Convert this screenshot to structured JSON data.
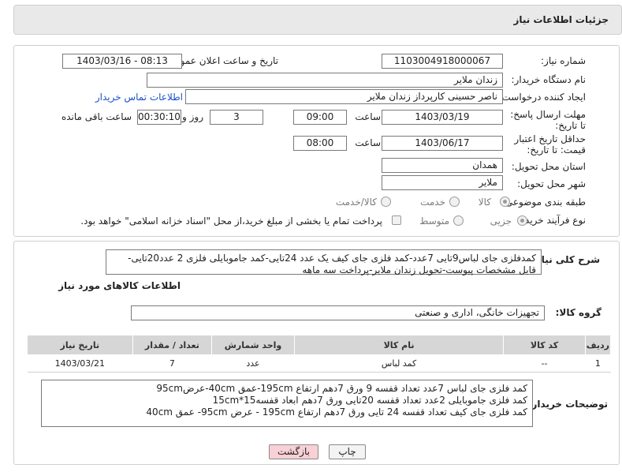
{
  "header": {
    "title": "جزئیات اطلاعات نیاز"
  },
  "form": {
    "need_number_label": "شماره نیاز:",
    "need_number": "1103004918000067",
    "announce_label": "تاریخ و ساعت اعلان عمومی:",
    "announce_value": "1403/03/16 - 08:13",
    "buyer_org_label": "نام دستگاه خریدار:",
    "buyer_org": "زندان ملایر",
    "creator_label": "ایجاد کننده درخواست:",
    "creator": "ناصر  حسینی کارپرداز زندان ملایر",
    "contact_link": "اطلاعات تماس خریدار",
    "reply_deadline_label": "مهلت ارسال پاسخ: تا تاریخ:",
    "reply_date": "1403/03/19",
    "time_label": "ساعت",
    "reply_time": "09:00",
    "days_value": "3",
    "days_label": "روز و",
    "remaining_value": "00:30:10",
    "remaining_label": "ساعت باقی مانده",
    "validity_label": "حداقل تاریخ اعتبار قیمت: تا تاریخ:",
    "validity_date": "1403/06/17",
    "validity_time_label": "ساعت",
    "validity_time": "08:00",
    "province_label": "استان محل تحویل:",
    "province": "همدان",
    "city_label": "شهر محل تحویل:",
    "city": "ملایر",
    "category_label": "طبقه بندی موضوعی:",
    "category_options": [
      "کالا",
      "خدمت",
      "کالا/خدمت"
    ],
    "purchase_type_label": "نوع فرآیند خرید :",
    "purchase_options": [
      "جزیی",
      "متوسط"
    ],
    "payment_note": "پرداخت تمام یا بخشی از مبلغ خرید،از محل \"اسناد خزانه اسلامی\" خواهد بود."
  },
  "summary": {
    "label": "شرح کلی نیاز:",
    "text": "کمدفلزی جای لباس9تایی 7عدد-کمد فلزی جای کیف یک عدد 24تایی-کمد جاموبایلی فلزی 2 عدد20تایی-قابل مشخصات پیوست-تحویل زندان ملایر-پرداخت سه ماهه"
  },
  "goods": {
    "section_title": "اطلاعات کالاهای مورد نیاز",
    "group_label": "گروه کالا:",
    "group_value": "تجهیزات خانگی، اداری و صنعتی",
    "columns": [
      "ردیف",
      "کد کالا",
      "نام کالا",
      "واحد شمارش",
      "تعداد / مقدار",
      "تاریخ نیاز"
    ],
    "rows": [
      {
        "row": "1",
        "code": "--",
        "name": "کمد لباس",
        "unit": "عدد",
        "qty": "7",
        "date": "1403/03/21"
      }
    ]
  },
  "buyer_desc": {
    "label": "توضیحات خریدار:",
    "lines": [
      "کمد فلزی جای لباس 7عدد تعداد قفسه 9 ورق 7دهم ارتفاع 195cm-عمق 40cm-عرض95cm",
      "کمد فلزی جاموبایلی 2عدد تعداد قفسه 20تایی ورق 7دهم ابعاد قفسه15*15cm",
      "کمد فلزی جای کیف تعداد قفسه 24 تایی ورق 7دهم ارتفاع 195cm - عرض 95cm- عمق 40cm"
    ]
  },
  "buttons": {
    "print": "چاپ",
    "back": "بازگشت"
  }
}
